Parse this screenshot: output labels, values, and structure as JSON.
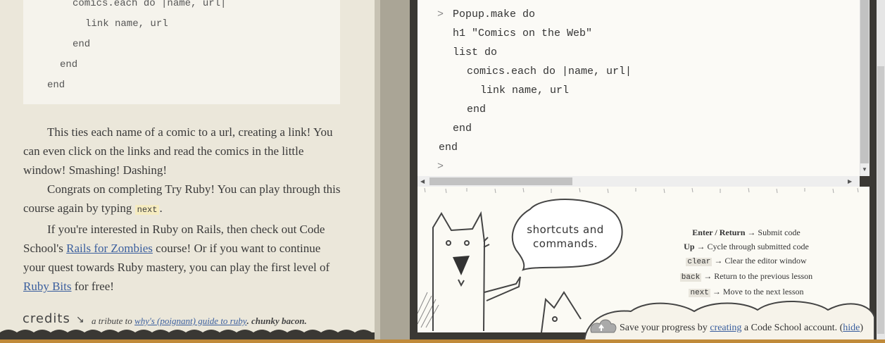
{
  "lesson": {
    "code_lines": [
      "comics.each do |name, url|",
      "link name, url",
      "end",
      "end",
      "end"
    ],
    "para1": "This ties each name of a comic to a url, creating a link! You can even click on the links and read the comics in the little window! Smashing! Dashing!",
    "para2_before": "Congrats on completing Try Ruby! You can play through this course again by typing ",
    "para2_code": "next",
    "para2_after": ".",
    "para3_a": "If you're interested in Ruby on Rails, then check out Code School's ",
    "para3_link1": "Rails for Zombies",
    "para3_b": " course! Or if you want to continue your quest towards Ruby mastery, you can play the first level of ",
    "para3_link2": "Ruby Bits",
    "para3_c": " for free!",
    "credits_label": "credits",
    "credits_prefix": "a tribute to ",
    "credits_link": "why's (poignant) guide to ruby",
    "credits_suffix": ". chunky bacon."
  },
  "terminal": {
    "prompt_symbol": ">",
    "lines": [
      "Popup.make do",
      "h1 \"Comics on the Web\"",
      "list do",
      "comics.each do |name, url|",
      "link name, url",
      "end",
      "end",
      "end"
    ]
  },
  "help": {
    "speech": "shortcuts and commands.",
    "hints": [
      {
        "key": "Enter / Return",
        "desc": "Submit code"
      },
      {
        "key": "Up",
        "desc": "Cycle through submitted code"
      },
      {
        "key": "clear",
        "desc": "Clear the editor window"
      },
      {
        "key": "back",
        "desc": "Return to the previous lesson"
      },
      {
        "key": "next",
        "desc": "Move to the next lesson"
      }
    ],
    "arrow": "→"
  },
  "save": {
    "before": "Save your progress by ",
    "link": "creating",
    "middle": " a Code School account. (",
    "hide": "hide",
    "after": ")"
  },
  "colors": {
    "link": "#3b5f9e",
    "accent": "#c08a3a",
    "console_frame": "#3a3834"
  }
}
